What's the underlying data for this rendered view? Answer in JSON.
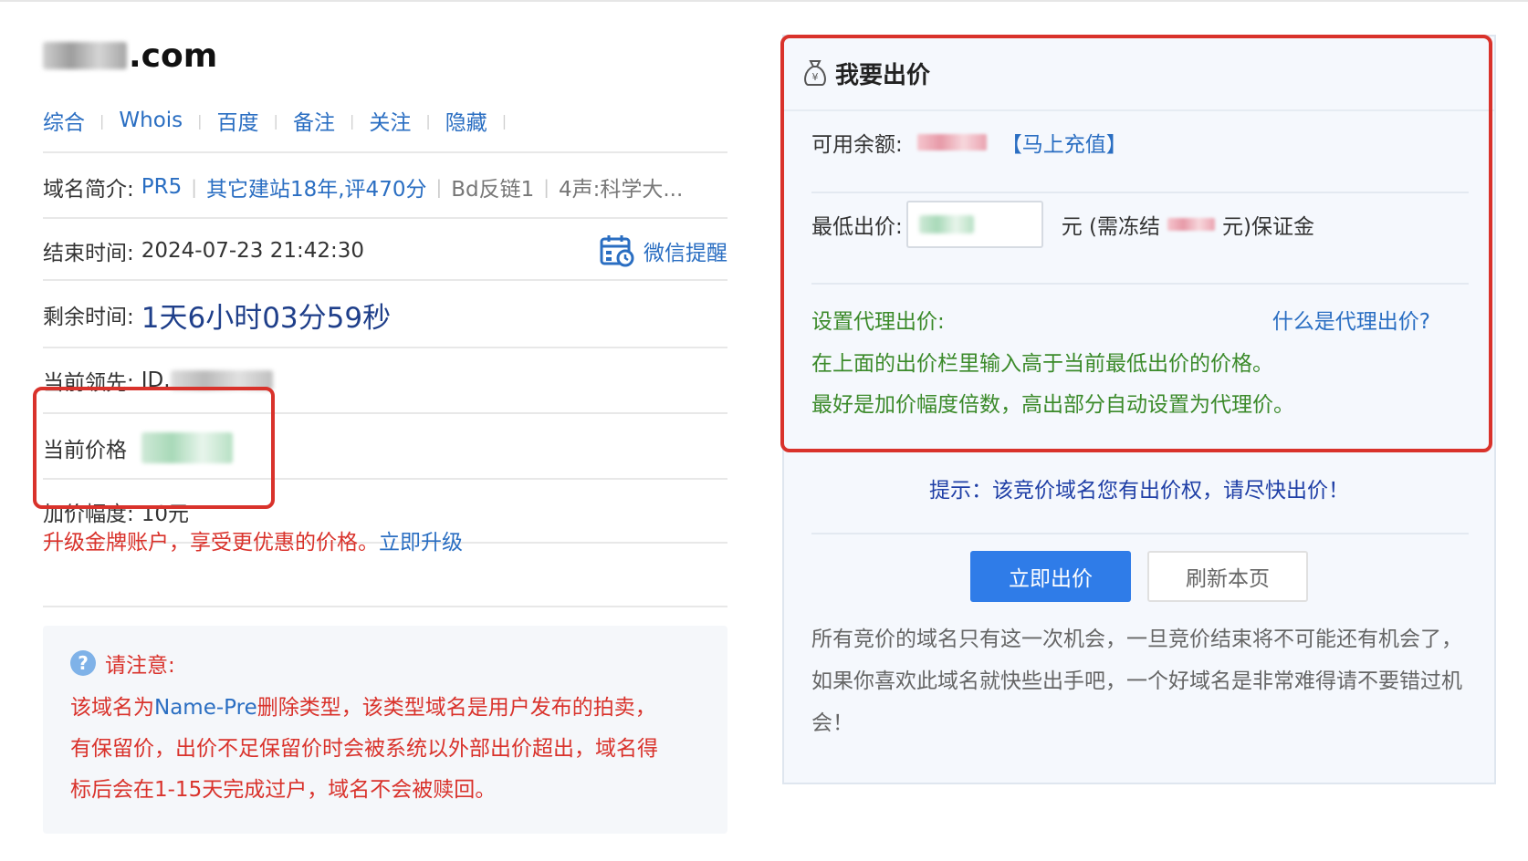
{
  "domain": {
    "suffix": ".com"
  },
  "tabs": [
    "综合",
    "Whois",
    "百度",
    "备注",
    "关注",
    "隐藏"
  ],
  "info": {
    "intro_label": "域名简介:",
    "pr": "PR5",
    "site_history": "其它建站18年,评470分",
    "backlinks": "Bd反链1",
    "tags": "4声:科学大...",
    "end_label": "结束时间:",
    "end_time": "2024-07-23 21:42:30",
    "wechat_remind": "微信提醒",
    "remain_label": "剩余时间:",
    "remain_time": "1天6小时03分59秒",
    "leader_label": "当前领先:",
    "leader_prefix": "ID.",
    "price_label": "当前价格",
    "increment_label": "加价幅度:",
    "increment_value": "10元"
  },
  "upgrade": {
    "text": "升级金牌账户，享受更优惠的价格。",
    "link": "立即升级"
  },
  "notice": {
    "title": "请注意:",
    "line1_a": "该域名为",
    "line1_type": "Name-Pre",
    "line1_b": "删除类型，该类型域名是用户发布的拍卖，",
    "line2": "有保留价，出价不足保留价时会被系统以外部出价超出，域名得",
    "line3": "标后会在1-15天完成过户，域名不会被赎回。"
  },
  "bid": {
    "title": "我要出价",
    "balance_label": "可用余额:",
    "recharge": "【马上充值】",
    "min_bid_label": "最低出价:",
    "unit_prefix": "元 (需冻结",
    "unit_suffix": "元)保证金",
    "proxy_label": "设置代理出价:",
    "proxy_help": "什么是代理出价?",
    "proxy_line1": "在上面的出价栏里输入高于当前最低出价的价格。",
    "proxy_line2": "最好是加价幅度倍数，高出部分自动设置为代理价。",
    "tip": "提示：该竞价域名您有出价权，请尽快出价！",
    "bid_button": "立即出价",
    "refresh_button": "刷新本页",
    "note": "所有竞价的域名只有这一次机会，一旦竞价结束将不可能还有机会了，如果你喜欢此域名就快些出手吧，一个好域名是非常难得请不要错过机会！"
  }
}
